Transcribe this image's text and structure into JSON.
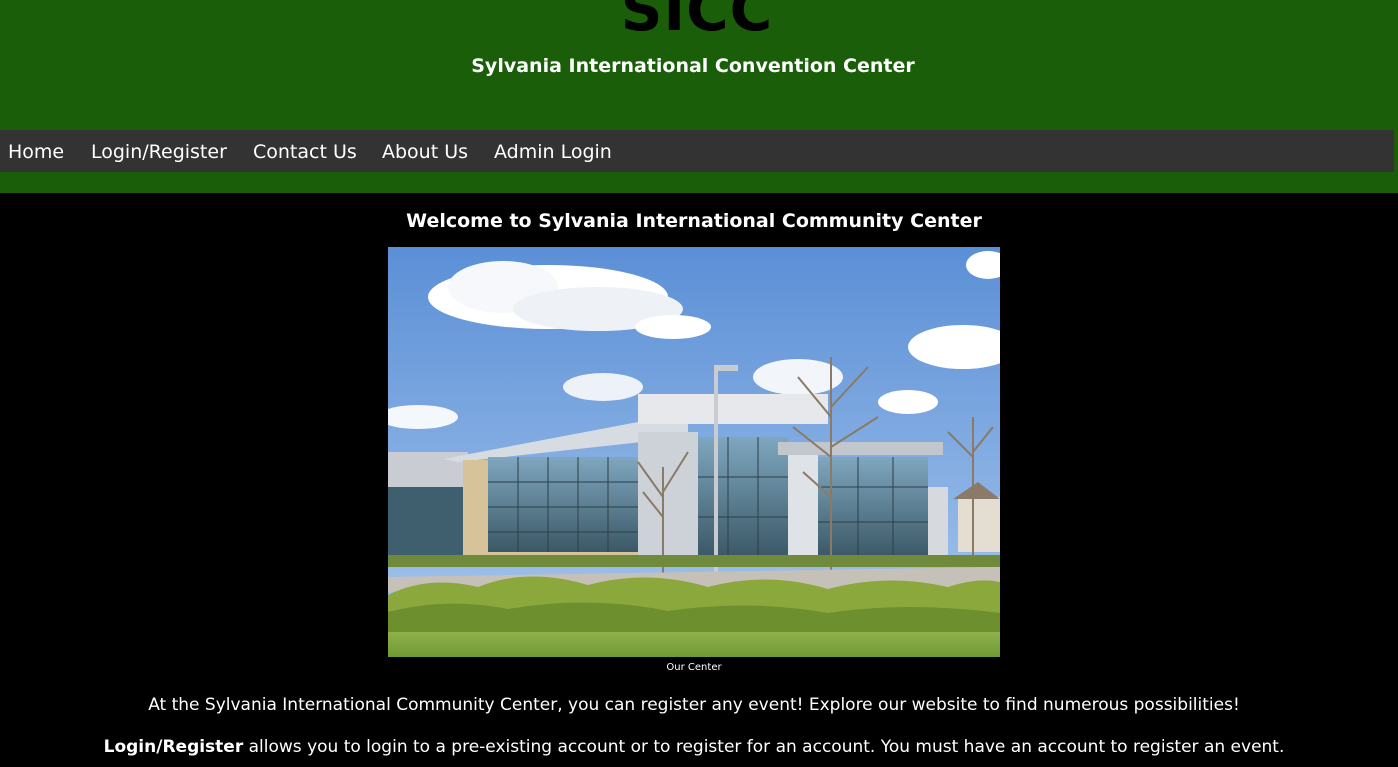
{
  "header": {
    "logo": "SICC",
    "subtitle": "Sylvania International Convention Center",
    "background_color": "#1a5e0a"
  },
  "nav": {
    "items": [
      {
        "label": "Home"
      },
      {
        "label": "Login/Register"
      },
      {
        "label": "Contact Us"
      },
      {
        "label": "About Us"
      },
      {
        "label": "Admin Login"
      }
    ],
    "background_color": "#333333"
  },
  "main": {
    "welcome_title": "Welcome to Sylvania International Community Center",
    "image_caption": "Our Center",
    "intro_text": "At the Sylvania International Community Center, you can register any event! Explore our website to find numerous possibilities!",
    "login_info": {
      "bold_label": "Login/Register",
      "text": " allows you to login to a pre-existing account or to register for an account. You must have an account to register an event."
    }
  }
}
